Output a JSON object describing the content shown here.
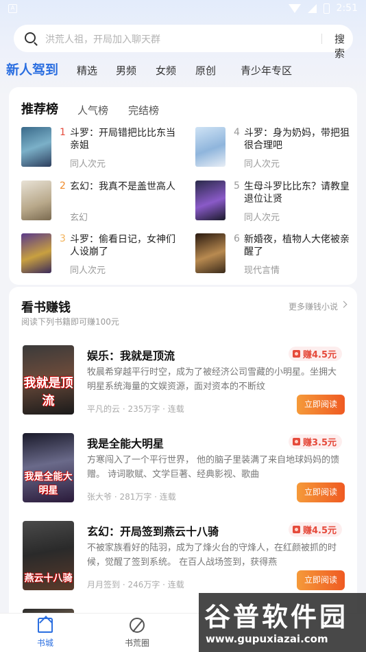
{
  "status": {
    "time": "2:51"
  },
  "search": {
    "placeholder": "洪荒人祖，开局加入聊天群",
    "button": "搜索"
  },
  "categories": [
    "新人驾到",
    "精选",
    "男频",
    "女频",
    "原创",
    "青少年专区"
  ],
  "ranking": {
    "tabs": [
      "推荐榜",
      "人气榜",
      "完结榜"
    ],
    "items": [
      {
        "rank": "1",
        "title": "斗罗：开局错把比比东当亲姐",
        "tag": "同人次元",
        "rank_color": "#e54a3b"
      },
      {
        "rank": "2",
        "title": "玄幻：我真不是盖世高人",
        "tag": "玄幻",
        "rank_color": "#ef8a2a"
      },
      {
        "rank": "3",
        "title": "斗罗：偷看日记，女神们人设崩了",
        "tag": "同人次元",
        "rank_color": "#f2b25a"
      },
      {
        "rank": "4",
        "title": "斗罗：身为奶妈，带把狙很合理吧",
        "tag": "同人次元",
        "rank_color": "#999999"
      },
      {
        "rank": "5",
        "title": "生母斗罗比比东？请教皇退位让贤",
        "tag": "同人次元",
        "rank_color": "#999999"
      },
      {
        "rank": "6",
        "title": "新婚夜，植物人大佬被亲醒了",
        "tag": "现代言情",
        "rank_color": "#999999"
      }
    ]
  },
  "earn": {
    "title": "看书赚钱",
    "subtitle": "阅读下列书籍即可赚100元",
    "more": "更多赚钱小说",
    "books": [
      {
        "title": "娱乐：我就是顶流",
        "desc": "牧晨希穿越平行时空，成为了被经济公司雪藏的小明星。坐拥大明星系统海量的文娱资源，面对资本的不断纹",
        "meta": "平凡的云 · 235万字 · 连载",
        "reward": "赚4.5元",
        "button": "立即阅读",
        "cover_text": "我就是顶流"
      },
      {
        "title": "我是全能大明星",
        "desc": "方寒闯入了一个平行世界， 他的脑子里装满了来自地球妈妈的馈赠。 诗词歌赋、文学巨著、经典影视、歌曲",
        "meta": "张大爷 · 281万字 · 连载",
        "reward": "赚3.5元",
        "button": "立即阅读",
        "cover_text": "我是全能大明星"
      },
      {
        "title": "玄幻：开局签到燕云十八骑",
        "desc": "不被家族看好的陆羽，成为了烽火台的守烽人，在红颜被抓的时候，觉醒了签到系统。 在百人战场签到，获得燕",
        "meta": "月月签到 · 246万字 · 连载",
        "reward": "赚4.5元",
        "button": "立即阅读",
        "cover_text": "燕云十八骑"
      }
    ]
  },
  "nav": [
    "书城",
    "书荒圈"
  ],
  "watermark": {
    "main": "谷普软件园",
    "url": "www.gupuxiazai.com"
  }
}
